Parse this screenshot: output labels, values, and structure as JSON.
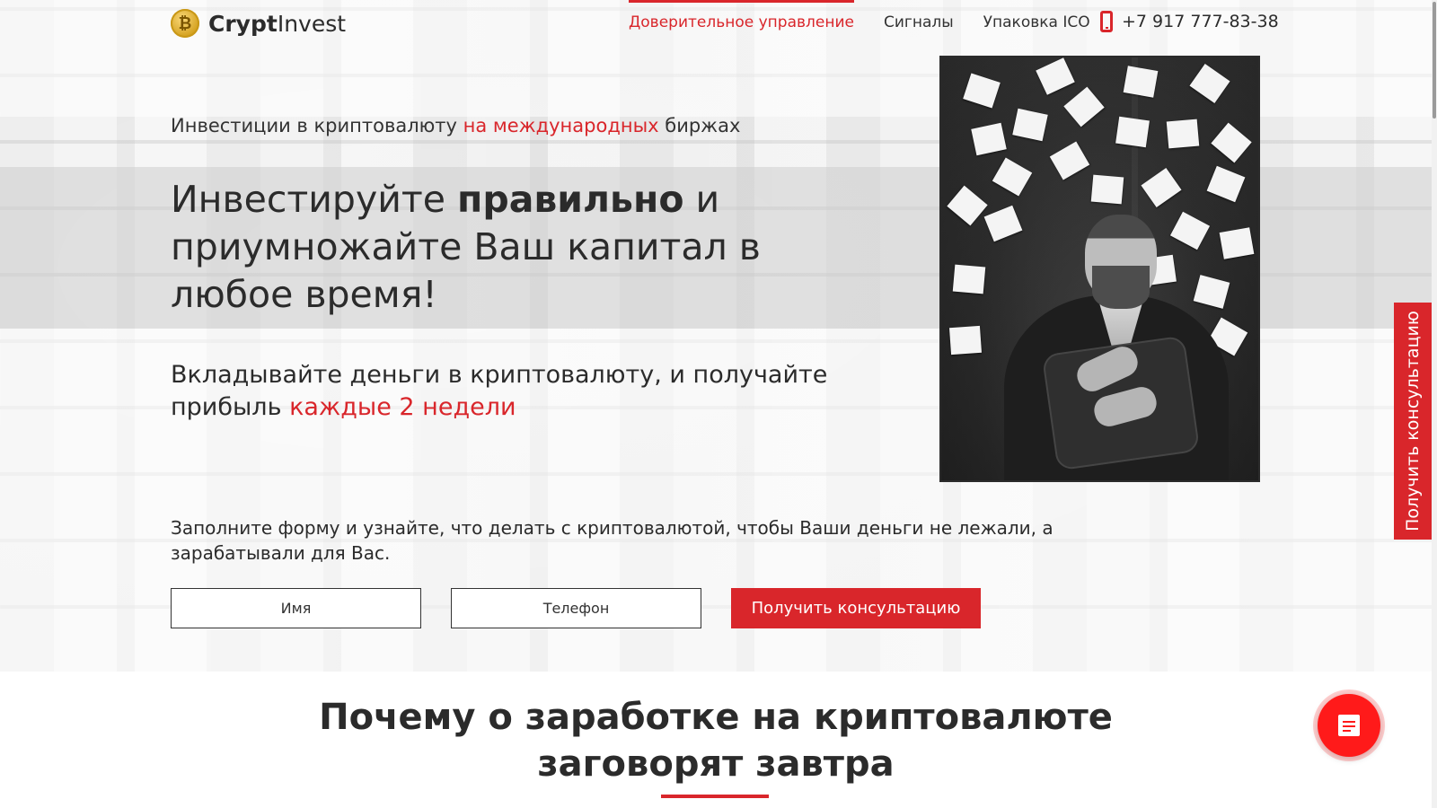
{
  "brand": {
    "name_bold": "Crypt",
    "name_regular": "Invest",
    "coin_symbol": "₿"
  },
  "nav": {
    "items": [
      {
        "label": "Доверительное управление",
        "active": true
      },
      {
        "label": "Сигналы",
        "active": false
      },
      {
        "label": "Упаковка ICO",
        "active": false
      }
    ],
    "phone": "+7 917 777-83-38"
  },
  "hero": {
    "eyebrow": {
      "before": "Инвестиции в криптовалюту ",
      "highlight": "на международных",
      "after": " биржах"
    },
    "headline": {
      "part1": "Инвестируйте ",
      "bold": "правильно",
      "part2": " и приумножайте Ваш капитал в любое время!"
    },
    "subline": {
      "text": "Вкладывайте деньги в криптовалюту, и получайте прибыль ",
      "highlight": "каждые 2 недели"
    },
    "form_text": "Заполните форму и узнайте, что делать с криптовалютой, чтобы Ваши деньги не лежали, а зарабатывали для Вас.",
    "form": {
      "name_placeholder": "Имя",
      "phone_placeholder": "Телефон",
      "submit_label": "Получить консультацию"
    }
  },
  "side_tab": {
    "label": "Получить консультацию"
  },
  "section": {
    "title_line1": "Почему о заработке на криптовалюте",
    "title_line2": "заговорят завтра"
  },
  "colors": {
    "accent": "#d9262b",
    "text": "#2b2b2b",
    "chat_button": "#ff1a1a"
  },
  "icons": {
    "phone": "phone-icon",
    "chat": "chat-icon",
    "logo": "bitcoin-coin-icon"
  }
}
